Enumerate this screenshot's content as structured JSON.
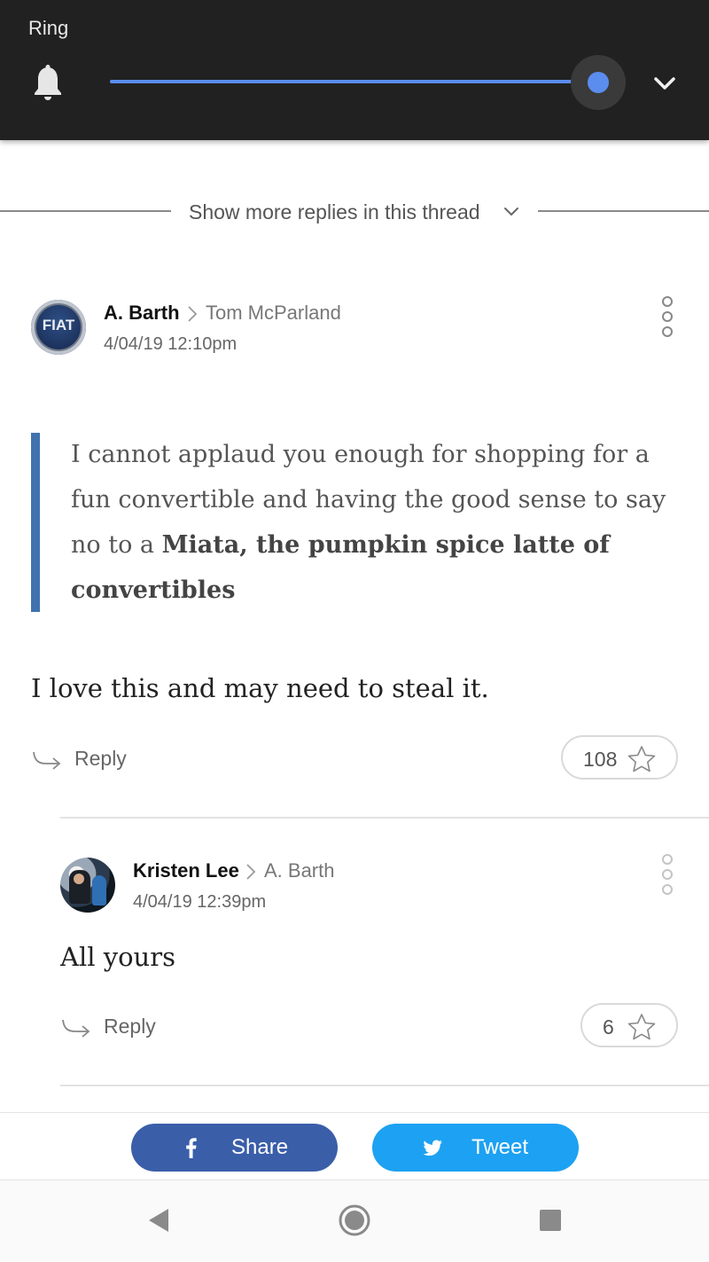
{
  "volume_panel": {
    "label": "Ring",
    "level": 1.0,
    "accent_color": "#5b8def",
    "icon": "bell-icon",
    "expand_icon": "chevron-down-icon"
  },
  "thread": {
    "show_more_label": "Show more replies in this thread"
  },
  "comments": [
    {
      "author": "A. Barth",
      "reply_to": "Tom McParland",
      "timestamp": "4/04/19 12:10pm",
      "avatar_text": "FIAT",
      "quote_plain": "I cannot applaud you enough for shopping for a fun convertible and having the good sense to say no to a ",
      "quote_bold": "Miata, the pumpkin spice latte of convertibles",
      "body": "I love this and may need to steal it.",
      "reply_label": "Reply",
      "likes": "108"
    },
    {
      "author": "Kristen Lee",
      "reply_to": "A. Barth",
      "timestamp": "4/04/19 12:39pm",
      "body": "All yours",
      "reply_label": "Reply",
      "likes": "6"
    }
  ],
  "share_bar": {
    "facebook_label": "Share",
    "twitter_label": "Tweet",
    "facebook_color": "#3b5ea9",
    "twitter_color": "#1da1f2"
  },
  "nav_bar": {
    "back_icon": "back-triangle-icon",
    "home_icon": "home-circle-icon",
    "recents_icon": "recents-square-icon"
  }
}
